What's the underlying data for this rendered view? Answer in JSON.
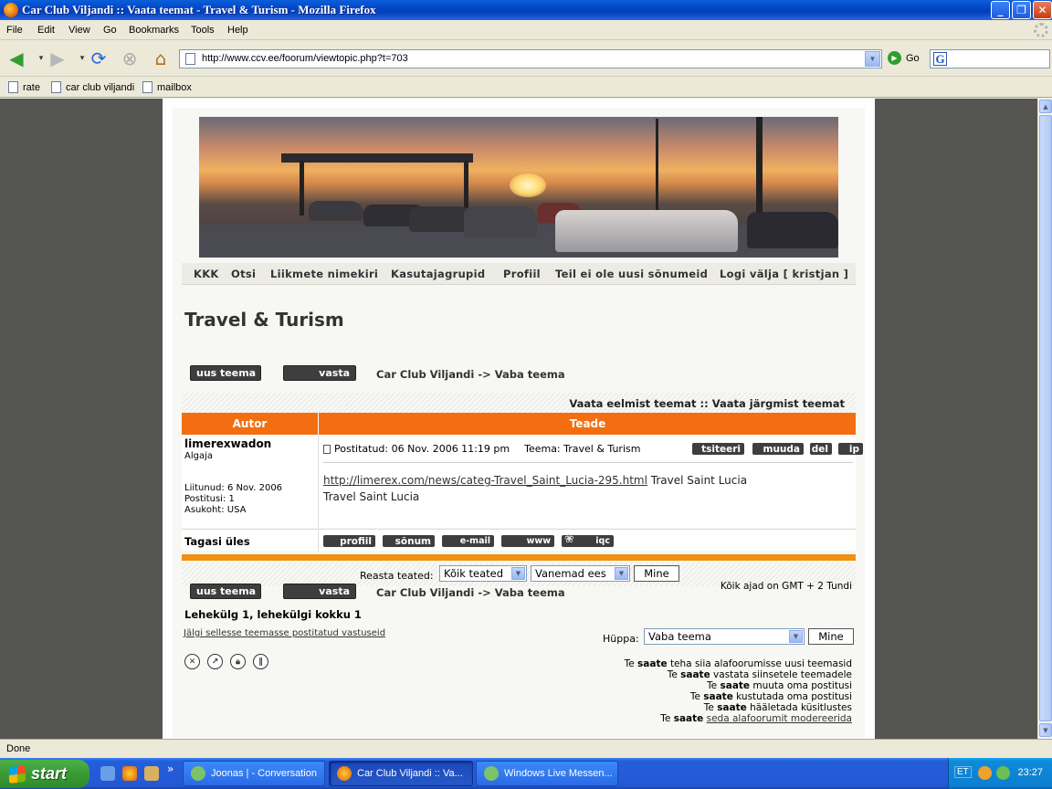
{
  "window": {
    "title": "Car Club Viljandi :: Vaata teemat - Travel & Turism - Mozilla Firefox"
  },
  "menu": [
    "File",
    "Edit",
    "View",
    "Go",
    "Bookmarks",
    "Tools",
    "Help"
  ],
  "toolbar": {
    "url": "http://www.ccv.ee/foorum/viewtopic.php?t=703",
    "go_label": "Go"
  },
  "bookmarks": [
    "rate",
    "car club viljandi",
    "mailbox"
  ],
  "forum": {
    "nav": [
      "KKK",
      "Otsi",
      "Liikmete nimekiri",
      "Kasutajagrupid",
      "Profiil",
      "Teil ei ole uusi sõnumeid",
      "Logi välja [ kristjan ]"
    ],
    "topic_title": "Travel & Turism",
    "new_topic": "uus teema",
    "reply": "vasta",
    "breadcrumb": "Car Club Viljandi -> Vaba teema",
    "prev_next": "Vaata eelmist teemat :: Vaata järgmist teemat",
    "col_author": "Autor",
    "col_message": "Teade",
    "post": {
      "author": "limerexwadon",
      "rank": "Algaja",
      "joined": "Liitunud: 6 Nov. 2006",
      "posts": "Postitusi: 1",
      "location": "Asukoht: USA",
      "posted": "Postitatud: 06 Nov. 2006 11:19 pm",
      "subject": "Teema: Travel & Turism",
      "actions": [
        "tsiteeri",
        "muuda",
        "del",
        "ip"
      ],
      "link": "http://limerex.com/news/categ-Travel_Saint_Lucia-295.html",
      "link_suffix": "Travel Saint Lucia",
      "text": "Travel Saint Lucia"
    },
    "back_to_top": "Tagasi üles",
    "profile_buttons": [
      "profiil",
      "sõnum",
      "e-mail",
      "www",
      "iqc"
    ],
    "sort": {
      "label": "Reasta teated:",
      "filter": "Kõik teated",
      "order": "Vanemad ees",
      "go": "Mine"
    },
    "timezone": "Kõik ajad on GMT + 2 Tundi",
    "pagination": "Lehekülg 1, lehekülgi kokku 1",
    "watch": "Jälgi sellesse teemasse postitatud vastuseid",
    "jump": {
      "label": "Hüppa:",
      "value": "Vaba teema",
      "go": "Mine"
    },
    "permissions": [
      {
        "pre": "Te",
        "bold": "saate",
        "post": "teha siia alafoorumisse uusi teemasid"
      },
      {
        "pre": "Te",
        "bold": "saate",
        "post": "vastata siinsetele teemadele"
      },
      {
        "pre": "Te",
        "bold": "saate",
        "post": "muuta oma postitusi"
      },
      {
        "pre": "Te",
        "bold": "saate",
        "post": "kustutada oma postitusi"
      },
      {
        "pre": "Te",
        "bold": "saate",
        "post": "hääletada küsitlustes"
      },
      {
        "pre": "Te",
        "bold": "saate",
        "post": "seda alafoorumit modereerida"
      }
    ]
  },
  "status": "Done",
  "taskbar": {
    "start": "start",
    "tasks": [
      "Joonas | - Conversation",
      "Car Club Viljandi :: Va...",
      "Windows Live Messen..."
    ],
    "lang": "ET",
    "clock": "23:27"
  }
}
